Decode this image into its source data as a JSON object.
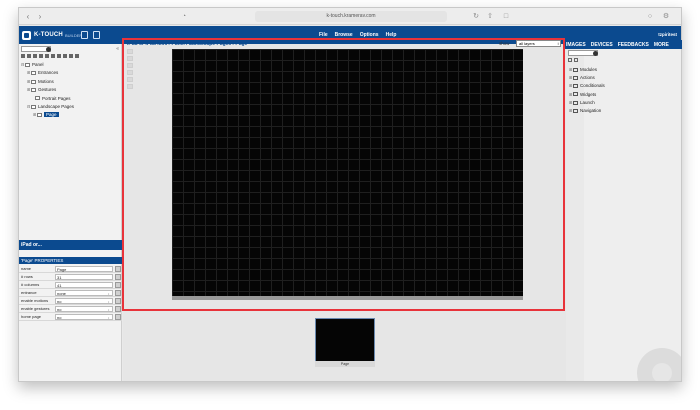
{
  "browser": {
    "url": "k-touch.kramerav.com",
    "back_icon": "chevron-left-icon",
    "forward_icon": "chevron-right-icon"
  },
  "app": {
    "brand": "K-TOUCH",
    "brand_sub": "BUILDER",
    "menu": [
      "File",
      "Browse",
      "Options",
      "Help"
    ],
    "user": "tzpiritest",
    "accent_color": "#0b4a8f",
    "highlight_color": "#e8333a"
  },
  "left_panel": {
    "tree": [
      {
        "label": "Panel",
        "level": 0,
        "twisty": "⊟"
      },
      {
        "label": "Entrances",
        "level": 1,
        "twisty": "⊞"
      },
      {
        "label": "Motions",
        "level": 1,
        "twisty": "⊞"
      },
      {
        "label": "Gestures",
        "level": 1,
        "twisty": "⊞"
      },
      {
        "label": "Portrait Pages",
        "level": 1,
        "twisty": ""
      },
      {
        "label": "Landscape Pages",
        "level": 1,
        "twisty": "⊟"
      },
      {
        "label": "Page",
        "level": 2,
        "twisty": "⊞",
        "selected": true
      }
    ],
    "device_bar": "iPad or...",
    "properties_title": "'Page' PROPERTIES",
    "properties": [
      {
        "key": "name",
        "value": "Page"
      },
      {
        "key": "# rows",
        "value": "31"
      },
      {
        "key": "# columns",
        "value": "41"
      },
      {
        "key": "entrance",
        "value": "none"
      },
      {
        "key": "enable motions",
        "value": "no"
      },
      {
        "key": "enable gestures",
        "value": "no"
      },
      {
        "key": "home page",
        "value": "no"
      }
    ]
  },
  "center": {
    "breadcrumb": "iPad or iPad Mini / Panel / Landscape Pages / Page",
    "show_label": "show",
    "layer_select": "all layers",
    "thumbnail_label": "Page"
  },
  "right_panel": {
    "tabs": [
      "IMAGES",
      "DEVICES",
      "FEEDBACKS",
      "MORE"
    ],
    "items": [
      "Modules",
      "Actions",
      "Conditionals",
      "Widgets",
      "Launch",
      "Navigation"
    ]
  }
}
